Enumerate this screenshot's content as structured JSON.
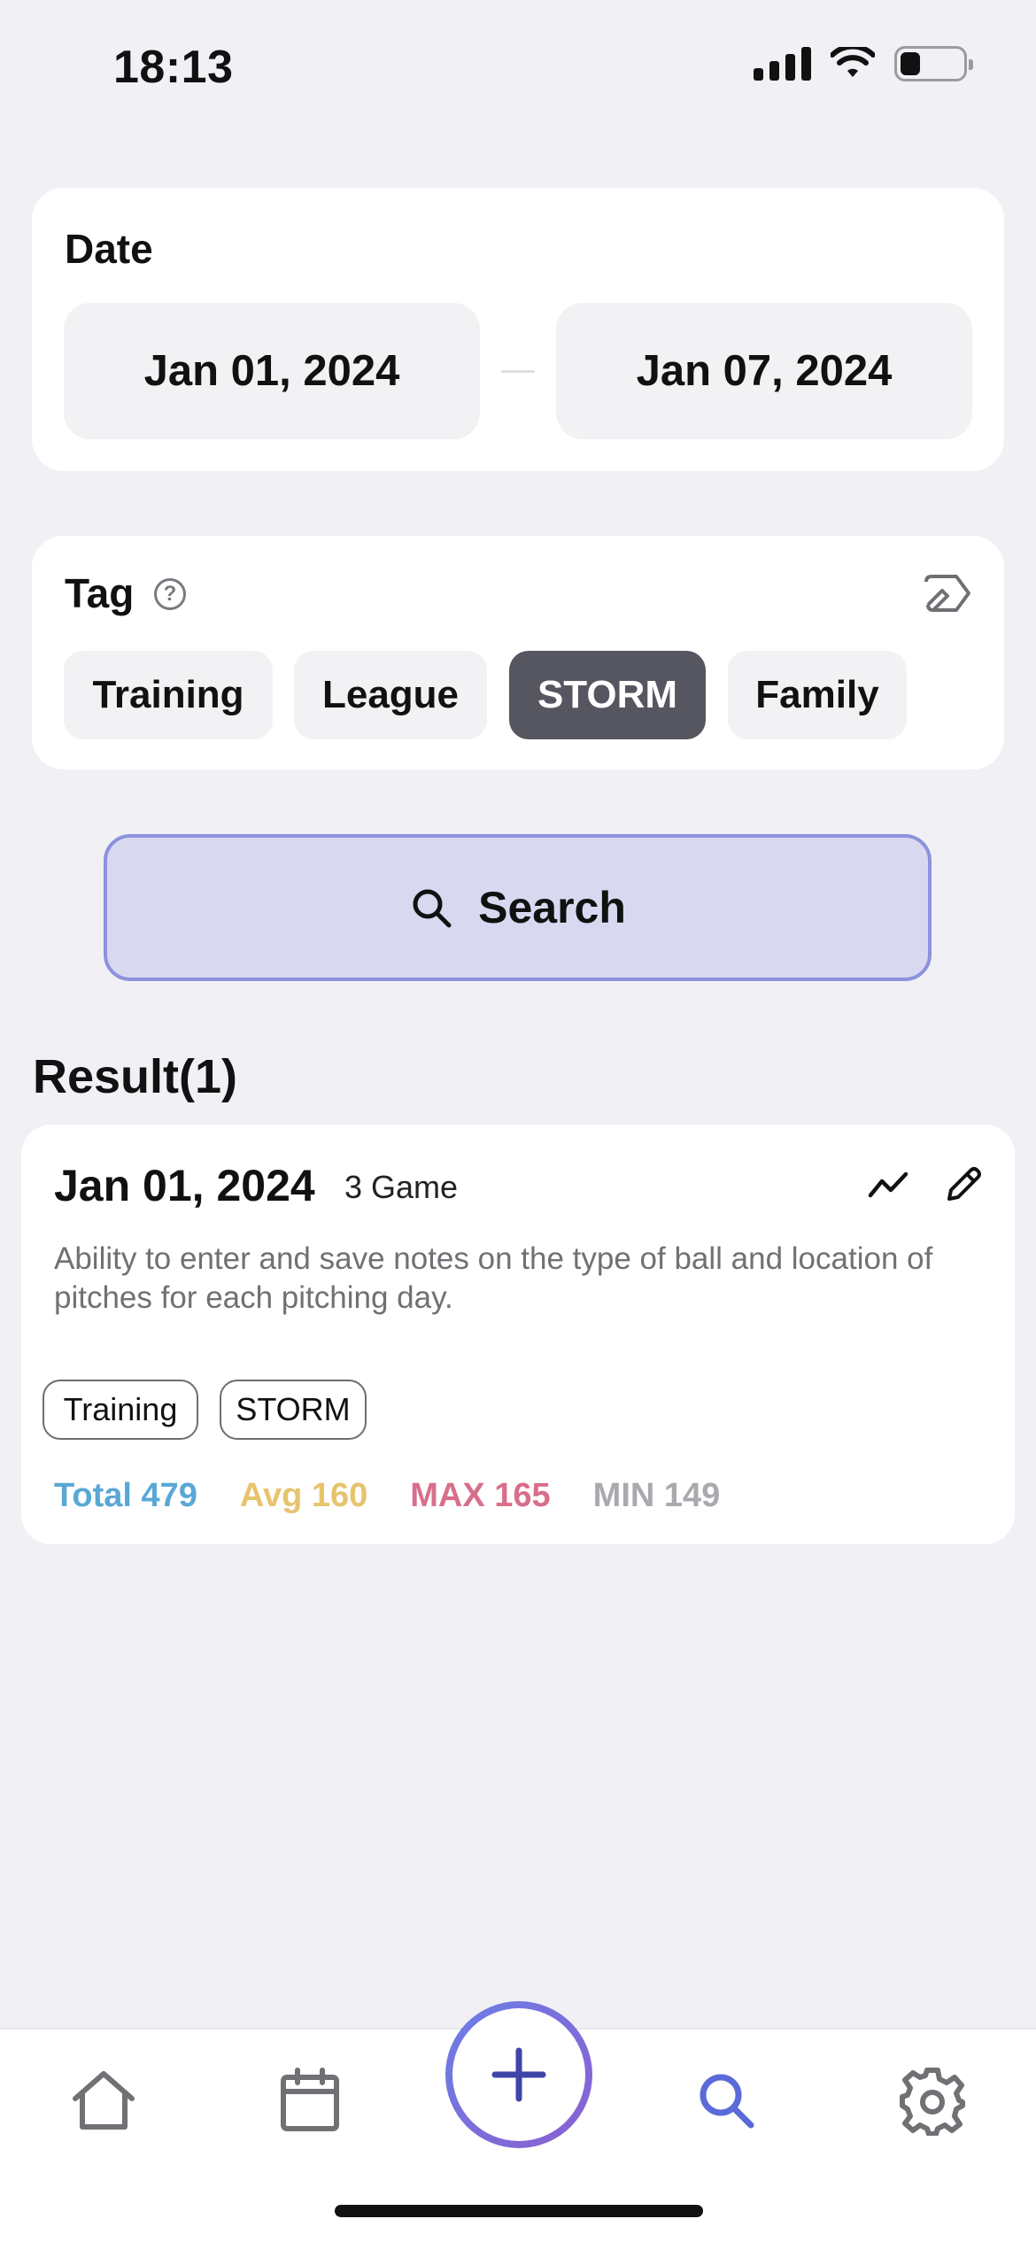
{
  "status_bar": {
    "time": "18:13"
  },
  "date_section": {
    "title": "Date",
    "start_date": "Jan 01, 2024",
    "end_date": "Jan 07, 2024"
  },
  "tag_section": {
    "title": "Tag",
    "help_glyph": "?",
    "chips": [
      {
        "label": "Training",
        "selected": false
      },
      {
        "label": "League",
        "selected": false
      },
      {
        "label": "STORM",
        "selected": true
      },
      {
        "label": "Family",
        "selected": false
      }
    ]
  },
  "search_button": {
    "label": "Search"
  },
  "results": {
    "title": "Result(1)",
    "items": [
      {
        "date": "Jan 01, 2024",
        "games": "3 Game",
        "note": "Ability to enter and save notes on the type of ball and location of pitches for each pitching day.",
        "tags": [
          "Training",
          "STORM"
        ],
        "stats": {
          "total": "Total 479",
          "avg": "Avg 160",
          "max": "MAX 165",
          "min": "MIN 149"
        }
      }
    ]
  },
  "colors": {
    "background": "#f1f0f5",
    "selected_chip": "#565660",
    "search_button_fill": "#d8d9f1",
    "search_button_border": "#8c92dc",
    "stat_total": "#5aa7d6",
    "stat_avg": "#e7c36c",
    "stat_max": "#d86f8a",
    "stat_min": "#a9a9ae",
    "active_tab": "#5a6ad8"
  },
  "tab_bar": {
    "tabs": [
      {
        "icon": "home-icon",
        "active": false
      },
      {
        "icon": "calendar-icon",
        "active": false
      },
      {
        "icon": "plus-icon",
        "active": false
      },
      {
        "icon": "search-icon",
        "active": true
      },
      {
        "icon": "gear-icon",
        "active": false
      }
    ]
  }
}
